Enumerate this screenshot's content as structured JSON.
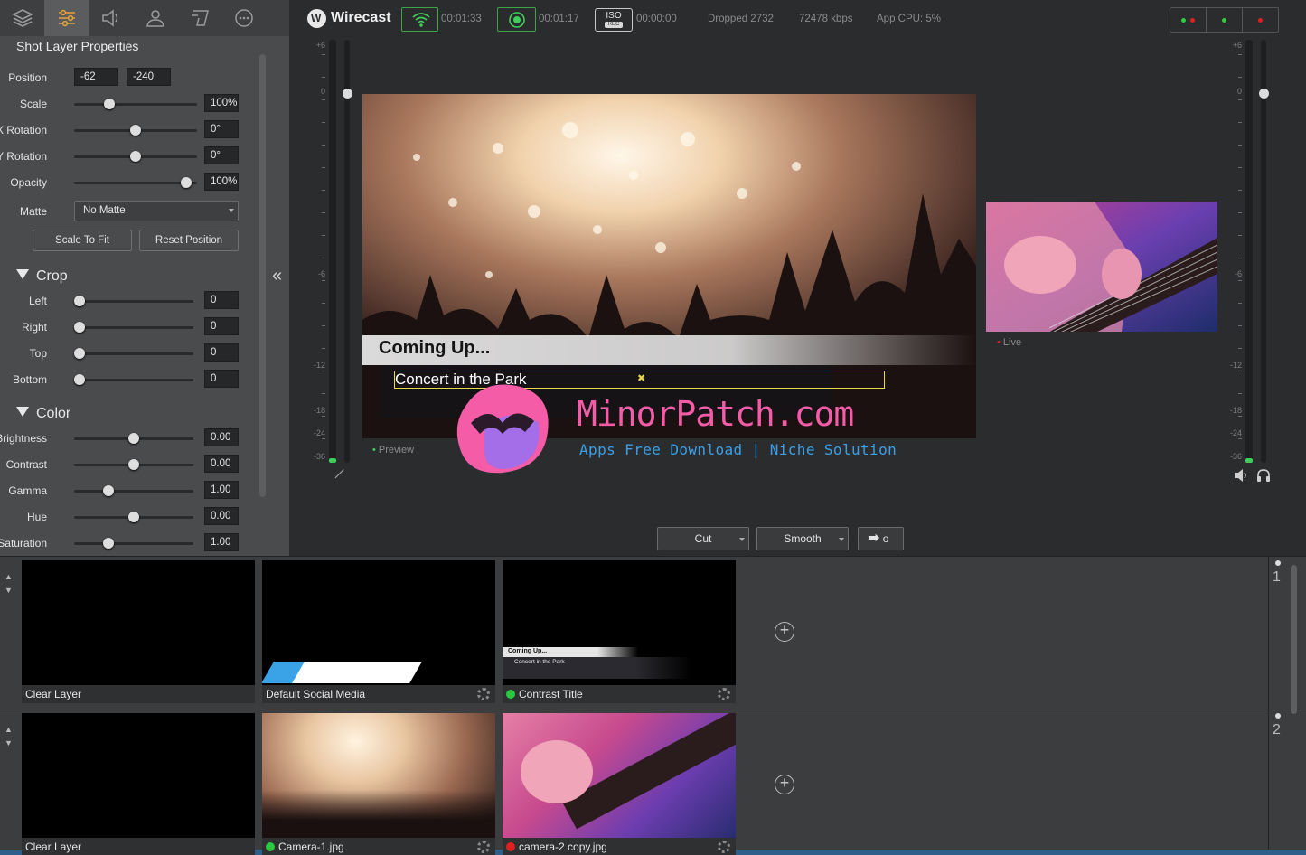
{
  "panel": {
    "title": "Shot Layer Properties",
    "tabs": [
      "layers-icon",
      "sliders-icon",
      "audio-icon",
      "person-icon",
      "text-icon",
      "more-icon"
    ],
    "position_label": "Position",
    "position_x": "-62",
    "position_y": "-240",
    "props": [
      {
        "label": "Scale",
        "value": "100%",
        "level": 0.27
      },
      {
        "label": "X Rotation",
        "value": "0°",
        "level": 0.5
      },
      {
        "label": "Y Rotation",
        "value": "0°",
        "level": 0.5
      },
      {
        "label": "Opacity",
        "value": "100%",
        "level": 0.95
      }
    ],
    "matte_label": "Matte",
    "matte_value": "No Matte",
    "scale_to_fit": "Scale To Fit",
    "reset_position": "Reset Position",
    "crop_title": "Crop",
    "crop": [
      {
        "label": "Left",
        "value": "0",
        "level": 0.0
      },
      {
        "label": "Right",
        "value": "0",
        "level": 0.0
      },
      {
        "label": "Top",
        "value": "0",
        "level": 0.0
      },
      {
        "label": "Bottom",
        "value": "0",
        "level": 0.0
      }
    ],
    "color_title": "Color",
    "color": [
      {
        "label": "Brightness",
        "value": "0.00",
        "level": 0.5
      },
      {
        "label": "Contrast",
        "value": "0.00",
        "level": 0.5
      },
      {
        "label": "Gamma",
        "value": "1.00",
        "level": 0.27
      },
      {
        "label": "Hue",
        "value": "0.00",
        "level": 0.5
      },
      {
        "label": "Saturation",
        "value": "1.00",
        "level": 0.27
      }
    ]
  },
  "topbar": {
    "app_name": "Wirecast",
    "stream_time": "00:01:33",
    "record_time": "00:01:17",
    "iso_label": "ISO",
    "iso_sub": "REC",
    "iso_time": "00:00:00",
    "dropped": "Dropped 2732",
    "bitrate": "72478 kbps",
    "cpu": "App CPU: 5%"
  },
  "meter_ticks_left": [
    "+6",
    "0",
    "-6",
    "-12",
    "-18",
    "-24",
    "-36"
  ],
  "meter_ticks_right": [
    "+6",
    "0",
    "-6",
    "-12",
    "-18",
    "-24",
    "-36"
  ],
  "preview": {
    "title_line": "Coming Up...",
    "subtitle_line": "Concert in the Park",
    "label": "Preview"
  },
  "live": {
    "label": "Live"
  },
  "watermark": {
    "name": "MinorPatch.com",
    "tagline": "Apps Free Download | Niche Solution"
  },
  "transitions": {
    "cut": "Cut",
    "smooth": "Smooth",
    "go_symbol": "o"
  },
  "layers": [
    {
      "number": "1",
      "shots": [
        {
          "label": "Clear Layer",
          "status": ""
        },
        {
          "label": "Default Social Media",
          "status": ""
        },
        {
          "label": "Contrast Title",
          "status": "#27c93f",
          "thumb_title": "Coming Up...",
          "thumb_sub": "Concert in the Park"
        }
      ]
    },
    {
      "number": "2",
      "shots": [
        {
          "label": "Clear Layer",
          "status": ""
        },
        {
          "label": "Camera-1.jpg",
          "status": "#27c93f"
        },
        {
          "label": "camera-2 copy.jpg",
          "status": "#e02020"
        }
      ]
    }
  ],
  "colors": {
    "accent_green": "#3ea34a",
    "live_red": "#e02020",
    "tab_active_icon": "#e7a23b"
  }
}
